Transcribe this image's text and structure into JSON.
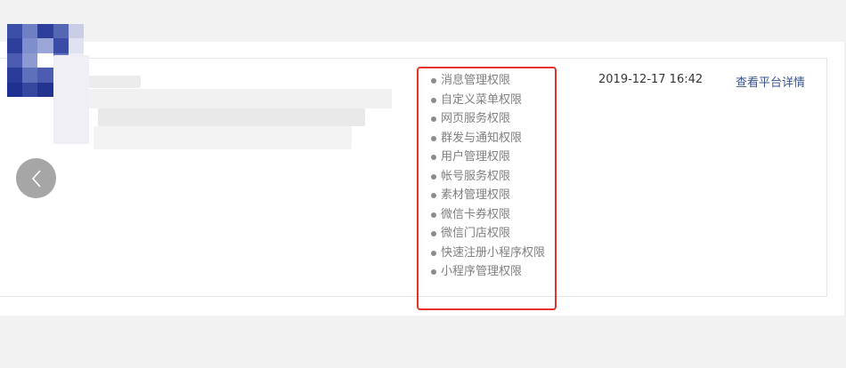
{
  "authorization_row": {
    "permissions": [
      "消息管理权限",
      "自定义菜单权限",
      "网页服务权限",
      "群发与通知权限",
      "用户管理权限",
      "帐号服务权限",
      "素材管理权限",
      "微信卡券权限",
      "微信门店权限",
      "快速注册小程序权限",
      "小程序管理权限"
    ],
    "authorized_time": "2019-12-17 16:42",
    "detail_link": "查看平台详情"
  },
  "colors": {
    "highlight_box": "#e8312a",
    "link": "#37538f",
    "prev_button": "#a6a6a6"
  },
  "icons": {
    "prev_button": "chevron-left-icon"
  }
}
